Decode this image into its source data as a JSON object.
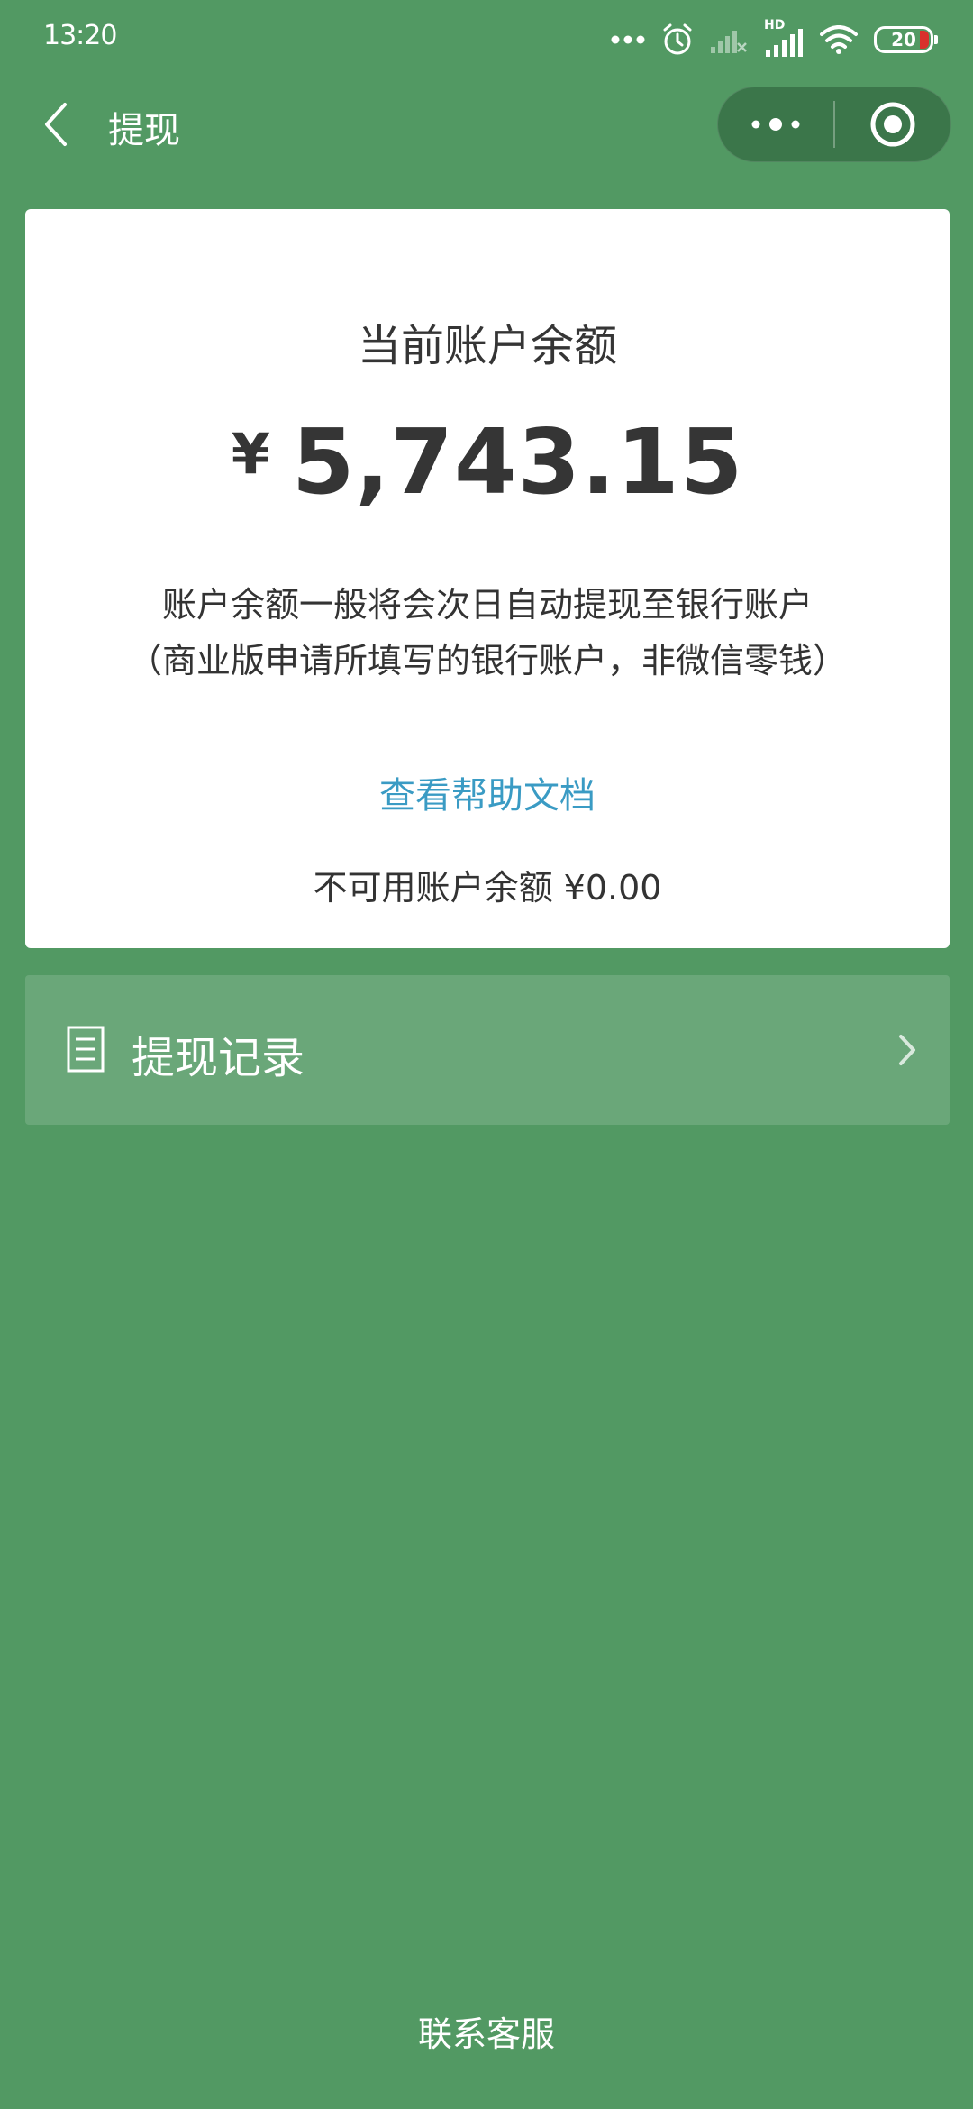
{
  "status_bar": {
    "time": "13:20",
    "hd_label": "HD",
    "battery_level": "20",
    "icons": [
      "more-dots-icon",
      "alarm-icon",
      "signal-weak-icon",
      "signal-hd-icon",
      "wifi-icon",
      "battery-icon"
    ]
  },
  "nav": {
    "title": "提现",
    "back_icon": "chevron-left-icon",
    "more_icon": "more-dots-icon",
    "close_icon": "target-close-icon"
  },
  "balance": {
    "title": "当前账户余额",
    "currency": "¥",
    "amount": "5,743.15",
    "desc_line1": "账户余额一般将会次日自动提现至银行账户",
    "desc_line2": "（商业版申请所填写的银行账户，非微信零钱）",
    "help_link": "查看帮助文档",
    "unavailable": "不可用账户余额 ¥0.00"
  },
  "records": {
    "label": "提现记录",
    "icon": "document-list-icon",
    "chevron": "chevron-right-icon"
  },
  "footer": {
    "contact": "联系客服"
  },
  "colors": {
    "background": "#529963",
    "card": "#ffffff",
    "link": "#3a9bc4",
    "battery_low": "#d9302c"
  }
}
